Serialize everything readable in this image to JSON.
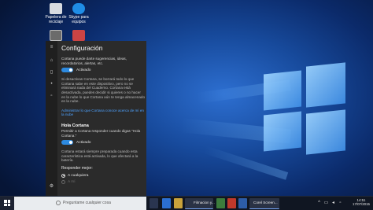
{
  "desktop": {
    "icons": [
      {
        "label": "Papelera de reciclaje"
      },
      {
        "label": "Skype para equipos"
      }
    ]
  },
  "cortana": {
    "title": "Configuración",
    "intro": "Cortana puede darte sugerencias, ideas, recordatorios, alertas, etc.",
    "toggle1_state": "Activado",
    "warning": "Si desactivas Cortana, se borrará todo lo que Cortana sabe en este dispositivo, pero no se eliminará nada del Cuaderno. Cortana está desactivada, puedes decidir si quieres o no hacer en la nube lo que Cortana aún te tenga almacenado en la nube.",
    "link": "Administrar lo que Cortana conoce acerca de mí en la nube",
    "hey_title": "Hola Cortana",
    "hey_desc": "Permitir a Cortana responder cuando digas \"Hola Cortana.\"",
    "toggle2_state": "Activado",
    "always_ready": "Cortana estará siempre preparada cuando esta característica está activada, lo que afectará a la batería.",
    "respond_label": "Responder mejor:",
    "radio1": "A cualquiera",
    "radio2": "A mí"
  },
  "taskbar": {
    "search_placeholder": "Preguntame cualquier cosa",
    "apps": [
      {
        "label": "Filmacion y..."
      },
      {
        "label": "Corel Screen..."
      }
    ],
    "time": "14:51",
    "date": "17/07/2015"
  }
}
